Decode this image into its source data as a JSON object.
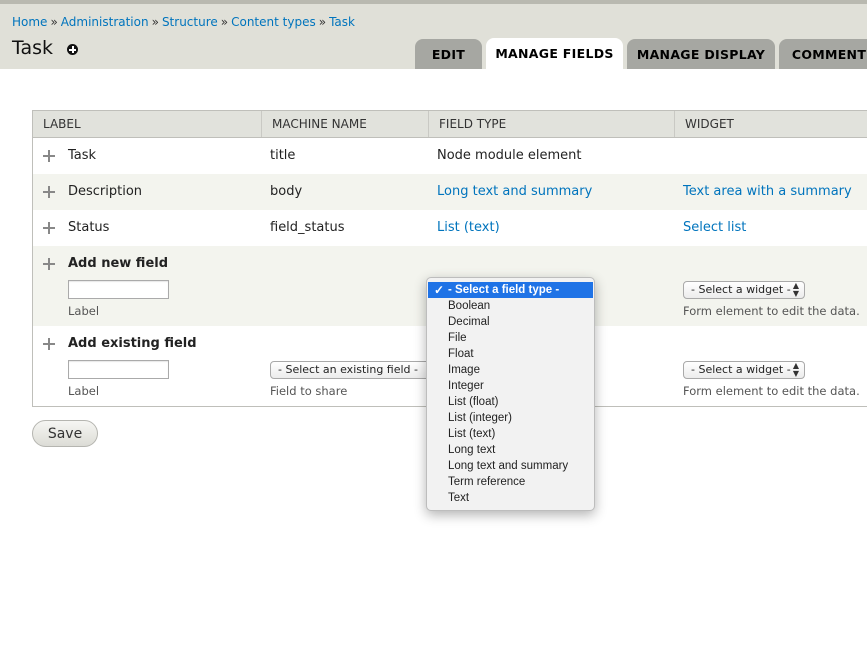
{
  "breadcrumb": [
    "Home",
    "Administration",
    "Structure",
    "Content types",
    "Task"
  ],
  "breadcrumb_separator": "»",
  "page_title": "Task",
  "tabs": [
    {
      "label": "EDIT",
      "active": false
    },
    {
      "label": "MANAGE FIELDS",
      "active": true
    },
    {
      "label": "MANAGE DISPLAY",
      "active": false
    },
    {
      "label": "COMMENT",
      "active": false
    }
  ],
  "table": {
    "headers": [
      "LABEL",
      "MACHINE NAME",
      "FIELD TYPE",
      "WIDGET"
    ],
    "rows": [
      {
        "label": "Task",
        "machine_name": "title",
        "field_type": "Node module element",
        "widget": ""
      },
      {
        "label": "Description",
        "machine_name": "body",
        "field_type": "Long text and summary",
        "widget": "Text area with a summary"
      },
      {
        "label": "Status",
        "machine_name": "field_status",
        "field_type": "List (text)",
        "widget": "Select list"
      }
    ],
    "add_new": {
      "title": "Add new field",
      "label_value": "",
      "label_caption": "Label",
      "widget_select": "- Select a widget -",
      "widget_caption": "Form element to edit the data."
    },
    "add_existing": {
      "title": "Add existing field",
      "label_value": "",
      "label_caption": "Label",
      "field_select": "- Select an existing field -",
      "field_caption": "Field to share",
      "widget_select": "- Select a widget -",
      "widget_caption": "Form element to edit the data."
    }
  },
  "save_label": "Save",
  "field_type_dropdown": {
    "selected": "- Select a field type -",
    "options": [
      "Boolean",
      "Decimal",
      "File",
      "Float",
      "Image",
      "Integer",
      "List (float)",
      "List (integer)",
      "List (text)",
      "Long text",
      "Long text and summary",
      "Term reference",
      "Text"
    ]
  },
  "colors": {
    "link": "#0074bd",
    "header_bg": "#e0e0d8",
    "tab_bg": "#a6a7a2",
    "selected_option": "#1f73e6"
  }
}
